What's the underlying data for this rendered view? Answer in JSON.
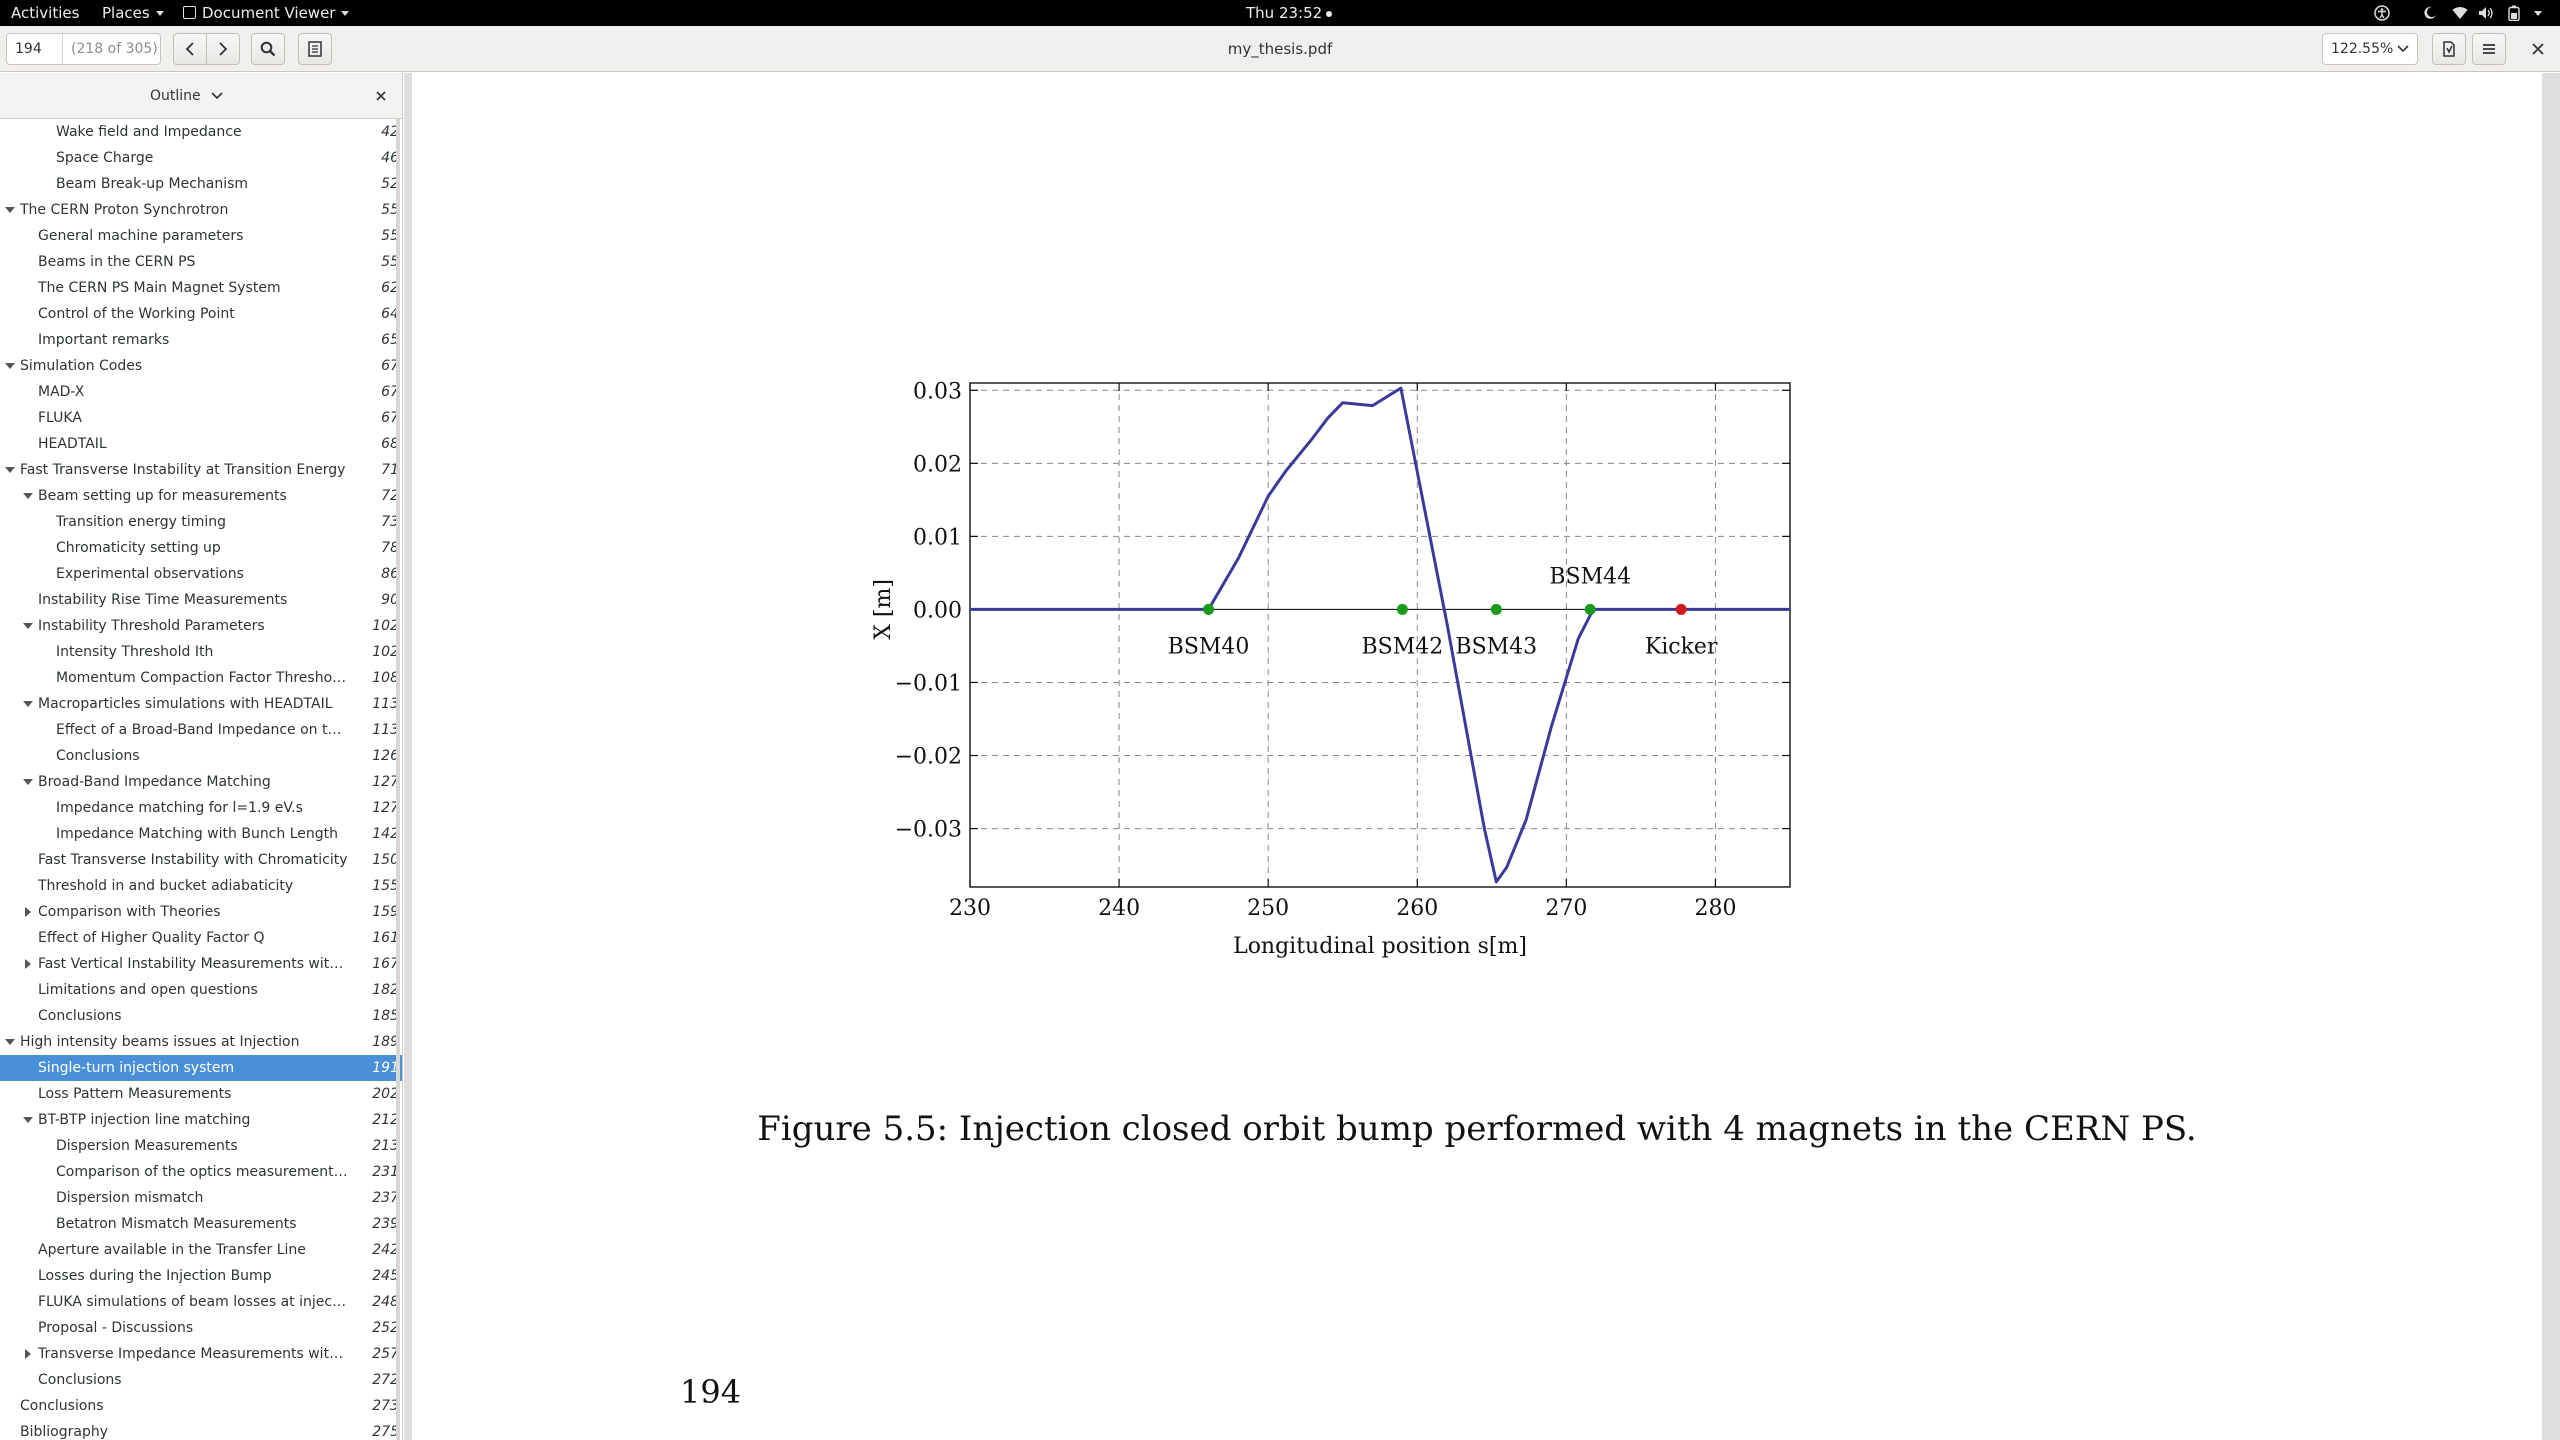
{
  "topbar": {
    "activities": "Activities",
    "places": "Places",
    "app_menu": "Document Viewer",
    "clock": "Thu 23:52"
  },
  "header": {
    "page_entry_value": "194",
    "page_of": "(218 of 305)",
    "title": "my_thesis.pdf",
    "zoom": "122.55%"
  },
  "sidebar": {
    "mode_label": "Outline",
    "items": [
      {
        "label": "Wake field and Impedance",
        "page": "42",
        "level": 2,
        "expander": "none"
      },
      {
        "label": "Space Charge",
        "page": "46",
        "level": 2,
        "expander": "none"
      },
      {
        "label": "Beam Break-up Mechanism",
        "page": "52",
        "level": 2,
        "expander": "none"
      },
      {
        "label": "The CERN Proton Synchrotron",
        "page": "55",
        "level": 0,
        "expander": "down"
      },
      {
        "label": "General machine parameters",
        "page": "55",
        "level": 1,
        "expander": "none"
      },
      {
        "label": "Beams in the CERN PS",
        "page": "55",
        "level": 1,
        "expander": "none"
      },
      {
        "label": "The CERN PS Main Magnet System",
        "page": "62",
        "level": 1,
        "expander": "none"
      },
      {
        "label": "Control of the Working Point",
        "page": "64",
        "level": 1,
        "expander": "none"
      },
      {
        "label": "Important remarks",
        "page": "65",
        "level": 1,
        "expander": "none"
      },
      {
        "label": "Simulation Codes",
        "page": "67",
        "level": 0,
        "expander": "down"
      },
      {
        "label": "MAD-X",
        "page": "67",
        "level": 1,
        "expander": "none"
      },
      {
        "label": "FLUKA",
        "page": "67",
        "level": 1,
        "expander": "none"
      },
      {
        "label": "HEADTAIL",
        "page": "68",
        "level": 1,
        "expander": "none"
      },
      {
        "label": "Fast Transverse Instability at Transition Energy",
        "page": "71",
        "level": 0,
        "expander": "down"
      },
      {
        "label": "Beam setting up for measurements",
        "page": "72",
        "level": 1,
        "expander": "down"
      },
      {
        "label": "Transition energy timing",
        "page": "73",
        "level": 2,
        "expander": "none"
      },
      {
        "label": "Chromaticity setting up",
        "page": "78",
        "level": 2,
        "expander": "none"
      },
      {
        "label": "Experimental observations",
        "page": "86",
        "level": 2,
        "expander": "none"
      },
      {
        "label": "Instability Rise Time Measurements",
        "page": "90",
        "level": 1,
        "expander": "none"
      },
      {
        "label": "Instability Threshold Parameters",
        "page": "102",
        "level": 1,
        "expander": "down"
      },
      {
        "label": "Intensity Threshold Ith",
        "page": "102",
        "level": 2,
        "expander": "none"
      },
      {
        "label": "Momentum Compaction Factor Threshold th",
        "page": "108",
        "level": 2,
        "expander": "none"
      },
      {
        "label": "Macroparticles simulations with HEADTAIL",
        "page": "113",
        "level": 1,
        "expander": "down"
      },
      {
        "label": "Effect of a Broad-Band Impedance on the Bea...",
        "page": "113",
        "level": 2,
        "expander": "none"
      },
      {
        "label": "Conclusions",
        "page": "126",
        "level": 2,
        "expander": "none"
      },
      {
        "label": "Broad-Band Impedance Matching",
        "page": "127",
        "level": 1,
        "expander": "down"
      },
      {
        "label": "Impedance matching for l=1.9 eV.s",
        "page": "127",
        "level": 2,
        "expander": "none"
      },
      {
        "label": "Impedance Matching with Bunch Length",
        "page": "142",
        "level": 2,
        "expander": "none"
      },
      {
        "label": "Fast Transverse Instability with Chromaticity",
        "page": "150",
        "level": 1,
        "expander": "none"
      },
      {
        "label": "Threshold in  and bucket adiabaticity",
        "page": "155",
        "level": 1,
        "expander": "none"
      },
      {
        "label": "Comparison with Theories",
        "page": "159",
        "level": 1,
        "expander": "right"
      },
      {
        "label": "Effect of Higher Quality Factor Q",
        "page": "161",
        "level": 1,
        "expander": "none"
      },
      {
        "label": "Fast Vertical Instability Measurements with Gam...",
        "page": "167",
        "level": 1,
        "expander": "right"
      },
      {
        "label": "Limitations and open questions",
        "page": "182",
        "level": 1,
        "expander": "none"
      },
      {
        "label": "Conclusions",
        "page": "185",
        "level": 1,
        "expander": "none"
      },
      {
        "label": "High intensity beams issues at Injection",
        "page": "189",
        "level": 0,
        "expander": "down"
      },
      {
        "label": "Single-turn injection system",
        "page": "191",
        "level": 1,
        "expander": "none",
        "selected": true
      },
      {
        "label": "Loss Pattern Measurements",
        "page": "202",
        "level": 1,
        "expander": "none"
      },
      {
        "label": "BT-BTP injection line matching",
        "page": "212",
        "level": 1,
        "expander": "down"
      },
      {
        "label": "Dispersion Measurements",
        "page": "213",
        "level": 2,
        "expander": "none"
      },
      {
        "label": "Comparison of the optics measurements with t...",
        "page": "231",
        "level": 2,
        "expander": "none"
      },
      {
        "label": "Dispersion mismatch",
        "page": "237",
        "level": 2,
        "expander": "none"
      },
      {
        "label": "Betatron Mismatch Measurements",
        "page": "239",
        "level": 2,
        "expander": "none"
      },
      {
        "label": "Aperture available in the Transfer Line",
        "page": "242",
        "level": 1,
        "expander": "none"
      },
      {
        "label": "Losses during the Injection Bump",
        "page": "245",
        "level": 1,
        "expander": "none"
      },
      {
        "label": "FLUKA simulations of beam losses at injection",
        "page": "248",
        "level": 1,
        "expander": "none"
      },
      {
        "label": "Proposal - Discussions",
        "page": "252",
        "level": 1,
        "expander": "none"
      },
      {
        "label": "Transverse Impedance Measurements with Betatr...",
        "page": "257",
        "level": 1,
        "expander": "right"
      },
      {
        "label": "Conclusions",
        "page": "272",
        "level": 1,
        "expander": "none"
      },
      {
        "label": "Conclusions",
        "page": "273",
        "level": 0,
        "expander": "none"
      },
      {
        "label": "Bibliography",
        "page": "275",
        "level": 0,
        "expander": "none"
      }
    ]
  },
  "document": {
    "caption": "Figure 5.5: Injection closed orbit bump performed with 4 magnets in the CERN PS.",
    "page_number": "194"
  },
  "chart_data": {
    "type": "line",
    "title": "",
    "xlabel": "Longitudinal position s[m]",
    "ylabel": "X [m]",
    "xlim": [
      230,
      285
    ],
    "ylim": [
      -0.038,
      0.031
    ],
    "xticks": [
      230,
      240,
      250,
      260,
      270,
      280
    ],
    "yticks": [
      0.03,
      0.02,
      0.01,
      0.0,
      -0.01,
      -0.02,
      -0.03
    ],
    "ytick_labels": [
      "0.03",
      "0.02",
      "0.01",
      "0.00",
      "−0.01",
      "−0.02",
      "−0.03"
    ],
    "grid": true,
    "series": [
      {
        "color": "#3a3a9a",
        "x": [
          230,
          246,
          248,
          250,
          251.2,
          253,
          254,
          255,
          257,
          258.9,
          262,
          264.5,
          265.3,
          266,
          267.3,
          269,
          270.8,
          271.8,
          285
        ],
        "y": [
          0,
          0,
          0.007,
          0.0155,
          0.019,
          0.0235,
          0.0262,
          0.0283,
          0.0279,
          0.0303,
          -0.002,
          -0.03,
          -0.0373,
          -0.0353,
          -0.0288,
          -0.016,
          -0.004,
          0,
          0
        ]
      }
    ],
    "markers": [
      {
        "label": "BSM40",
        "x": 246.0,
        "y": 0,
        "color": "#1a9a1a",
        "label_pos": "below"
      },
      {
        "label": "BSM42",
        "x": 259.0,
        "y": 0,
        "color": "#1a9a1a",
        "label_pos": "below"
      },
      {
        "label": "BSM43",
        "x": 265.3,
        "y": 0,
        "color": "#1a9a1a",
        "label_pos": "below"
      },
      {
        "label": "BSM44",
        "x": 271.6,
        "y": 0,
        "color": "#1a9a1a",
        "label_pos": "above"
      },
      {
        "label": "Kicker",
        "x": 277.7,
        "y": 0,
        "color": "#d01a1a",
        "label_pos": "below"
      }
    ]
  }
}
